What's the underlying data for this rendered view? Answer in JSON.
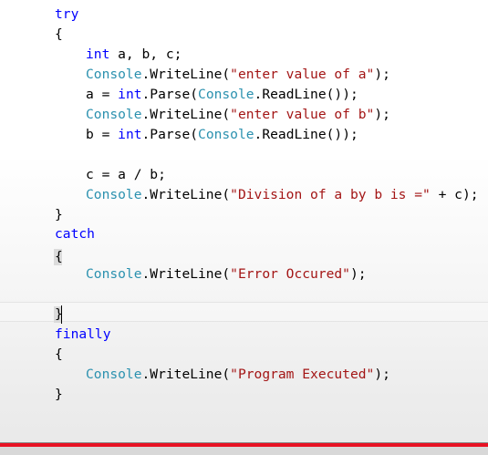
{
  "editor": {
    "lines": [
      [
        {
          "t": "try",
          "c": "kw"
        }
      ],
      [
        {
          "t": "{",
          "c": "pl"
        }
      ],
      [
        {
          "t": "int",
          "c": "kw"
        },
        {
          "t": " a, b, c;",
          "c": "pl"
        }
      ],
      [
        {
          "t": "Console",
          "c": "typ"
        },
        {
          "t": ".WriteLine(",
          "c": "pl"
        },
        {
          "t": "\"enter value of a\"",
          "c": "str"
        },
        {
          "t": ");",
          "c": "pl"
        }
      ],
      [
        {
          "t": "a = ",
          "c": "pl"
        },
        {
          "t": "int",
          "c": "kw"
        },
        {
          "t": ".Parse(",
          "c": "pl"
        },
        {
          "t": "Console",
          "c": "typ"
        },
        {
          "t": ".ReadLine());",
          "c": "pl"
        }
      ],
      [
        {
          "t": "Console",
          "c": "typ"
        },
        {
          "t": ".WriteLine(",
          "c": "pl"
        },
        {
          "t": "\"enter value of b\"",
          "c": "str"
        },
        {
          "t": ");",
          "c": "pl"
        }
      ],
      [
        {
          "t": "b = ",
          "c": "pl"
        },
        {
          "t": "int",
          "c": "kw"
        },
        {
          "t": ".Parse(",
          "c": "pl"
        },
        {
          "t": "Console",
          "c": "typ"
        },
        {
          "t": ".ReadLine());",
          "c": "pl"
        }
      ],
      [],
      [
        {
          "t": "c = a / b;",
          "c": "pl"
        }
      ],
      [
        {
          "t": "Console",
          "c": "typ"
        },
        {
          "t": ".WriteLine(",
          "c": "pl"
        },
        {
          "t": "\"Division of a by b is =\"",
          "c": "str"
        },
        {
          "t": " + c);",
          "c": "pl"
        }
      ],
      [
        {
          "t": "}",
          "c": "pl"
        }
      ],
      [
        {
          "t": "catch",
          "c": "kw"
        }
      ],
      [
        {
          "t": "{",
          "c": "pl"
        }
      ],
      [],
      [
        {
          "t": "Console",
          "c": "typ"
        },
        {
          "t": ".WriteLine(",
          "c": "pl"
        },
        {
          "t": "\"Error Occured\"",
          "c": "str"
        },
        {
          "t": ");",
          "c": "pl"
        }
      ],
      [],
      [
        {
          "t": "}",
          "c": "pl"
        }
      ],
      [
        {
          "t": "finally",
          "c": "kw"
        }
      ],
      [
        {
          "t": "{",
          "c": "pl"
        }
      ],
      [
        {
          "t": "Console",
          "c": "typ"
        },
        {
          "t": ".WriteLine(",
          "c": "pl"
        },
        {
          "t": "\"Program Executed\"",
          "c": "str"
        },
        {
          "t": ");",
          "c": "pl"
        }
      ],
      [
        {
          "t": "}",
          "c": "pl"
        }
      ]
    ]
  },
  "colors": {
    "keyword": "#0000ff",
    "type": "#2b91af",
    "string": "#a31515",
    "plain": "#000000",
    "bottom_bar": "#e81123"
  }
}
